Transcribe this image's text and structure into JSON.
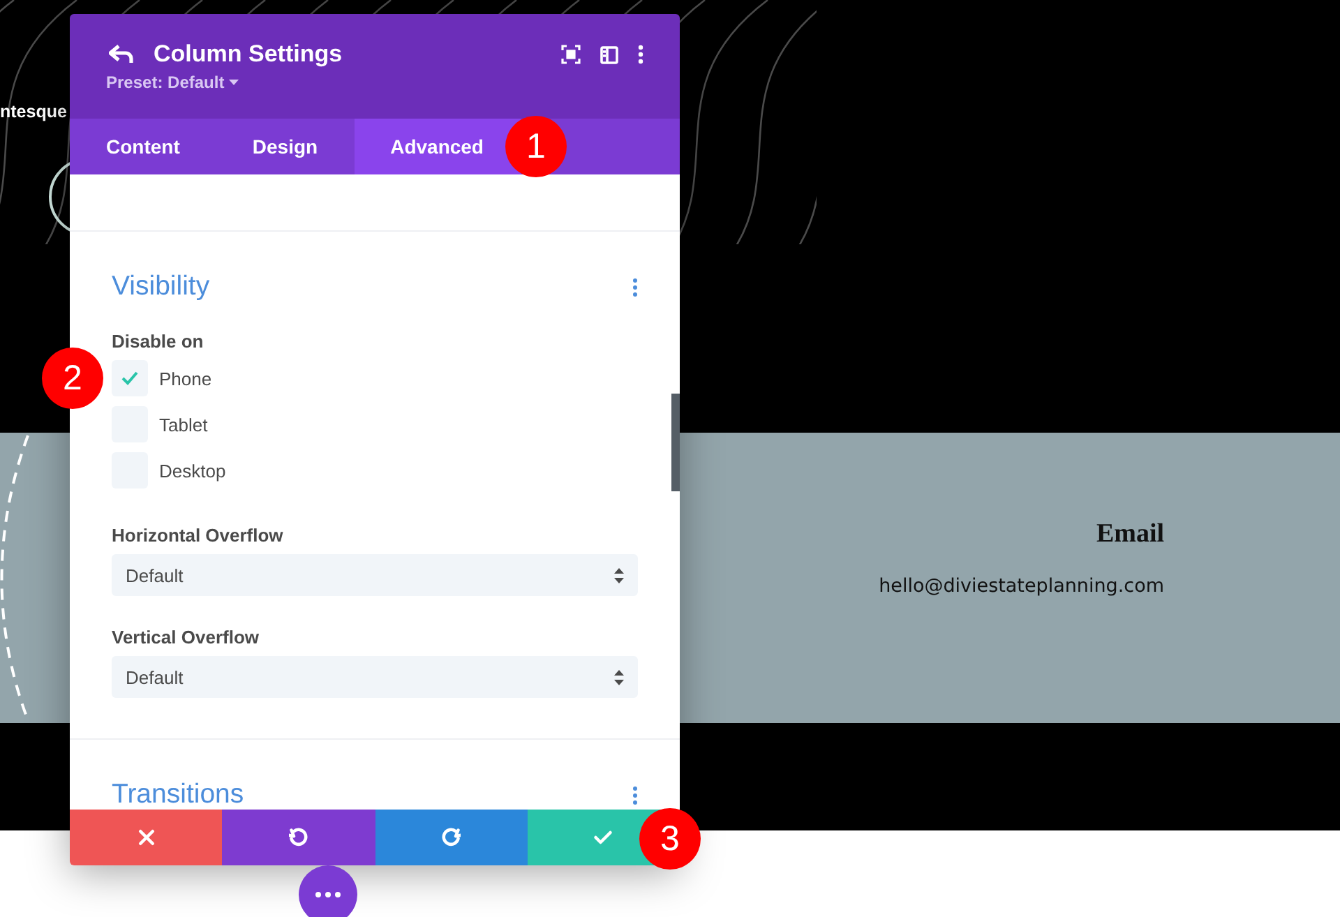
{
  "background": {
    "side_text": "ntesque",
    "contact": {
      "heading": "Email",
      "email": "hello@diviestateplanning.com"
    }
  },
  "panel": {
    "title": "Column Settings",
    "preset": "Preset: Default",
    "tabs": [
      {
        "label": "Content",
        "selected": false
      },
      {
        "label": "Design",
        "selected": false
      },
      {
        "label": "Advanced",
        "selected": true
      }
    ],
    "sections": [
      {
        "title": "Visibility",
        "fields": [
          {
            "kind": "checkboxes",
            "label": "Disable on",
            "options": [
              {
                "label": "Phone",
                "checked": true
              },
              {
                "label": "Tablet",
                "checked": false
              },
              {
                "label": "Desktop",
                "checked": false
              }
            ]
          },
          {
            "kind": "select",
            "label": "Horizontal Overflow",
            "value": "Default"
          },
          {
            "kind": "select",
            "label": "Vertical Overflow",
            "value": "Default"
          }
        ]
      },
      {
        "title": "Transitions"
      }
    ]
  },
  "actions": [
    {
      "kind": "cancel"
    },
    {
      "kind": "undo"
    },
    {
      "kind": "redo"
    },
    {
      "kind": "save"
    }
  ],
  "callouts": [
    "1",
    "2",
    "3"
  ]
}
